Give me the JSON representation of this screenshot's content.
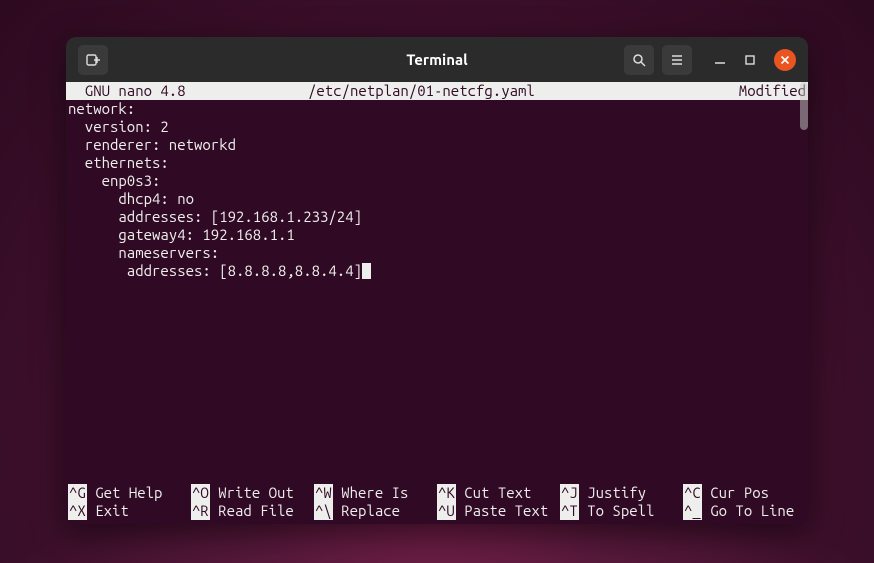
{
  "window": {
    "title": "Terminal"
  },
  "nano": {
    "header": {
      "left": "  GNU nano 4.8",
      "center": "/etc/netplan/01-netcfg.yaml",
      "right": "Modified"
    },
    "content": "network:\n  version: 2\n  renderer: networkd\n  ethernets:\n    enp0s3:\n      dhcp4: no\n      addresses: [192.168.1.233/24]\n      gateway4: 192.168.1.1\n      nameservers:\n       addresses: [8.8.8.8,8.8.4.4]",
    "shortcuts": [
      {
        "key": "^G",
        "label": " Get Help"
      },
      {
        "key": "^O",
        "label": " Write Out"
      },
      {
        "key": "^W",
        "label": " Where Is"
      },
      {
        "key": "^K",
        "label": " Cut Text"
      },
      {
        "key": "^J",
        "label": " Justify"
      },
      {
        "key": "^C",
        "label": " Cur Pos"
      },
      {
        "key": "^X",
        "label": " Exit"
      },
      {
        "key": "^R",
        "label": " Read File"
      },
      {
        "key": "^\\",
        "label": " Replace"
      },
      {
        "key": "^U",
        "label": " Paste Text"
      },
      {
        "key": "^T",
        "label": " To Spell"
      },
      {
        "key": "^_",
        "label": " Go To Line"
      }
    ]
  }
}
